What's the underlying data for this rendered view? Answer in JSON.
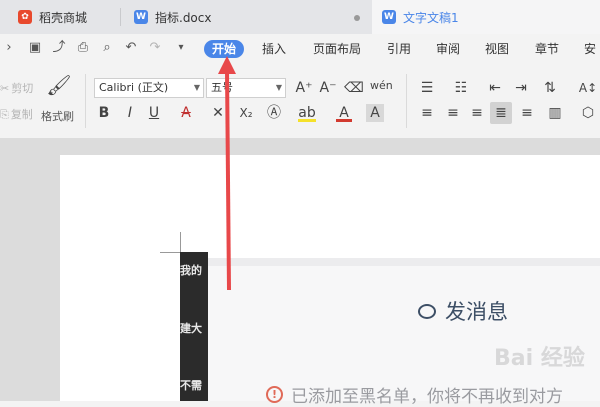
{
  "tabs": [
    {
      "label": "稻壳商城",
      "icon": "docer-icon",
      "color": "#e8492d"
    },
    {
      "label": "指标.docx",
      "icon": "word-doc-icon",
      "color": "#4a86e8"
    },
    {
      "label": "文字文稿1",
      "icon": "word-doc-icon",
      "color": "#4a86e8"
    }
  ],
  "menu": {
    "start": "开始",
    "insert": "插入",
    "layout": "页面布局",
    "references": "引用",
    "review": "审阅",
    "view": "视图",
    "chapter": "章节",
    "security": "安"
  },
  "clipboard": {
    "cut": "剪切",
    "copy": "复制",
    "format_painter": "格式刷"
  },
  "font": {
    "family": "Calibri (正文)",
    "size": "五号",
    "bold": "B",
    "italic": "I",
    "underline": "U",
    "strike": "A",
    "superscript": "X²",
    "subscript": "X₂",
    "grow": "A⁺",
    "shrink": "A⁻",
    "pinyin": "wén"
  },
  "document": {
    "send_message": "发消息",
    "blocked_notice": "已添加至黑名单，你将不再收到对方",
    "watermark": "Bai 经验",
    "left_fragments": [
      "我的",
      "建大",
      "不需"
    ]
  },
  "colors": {
    "accent": "#4a86e8",
    "arrow": "#e8484a"
  }
}
